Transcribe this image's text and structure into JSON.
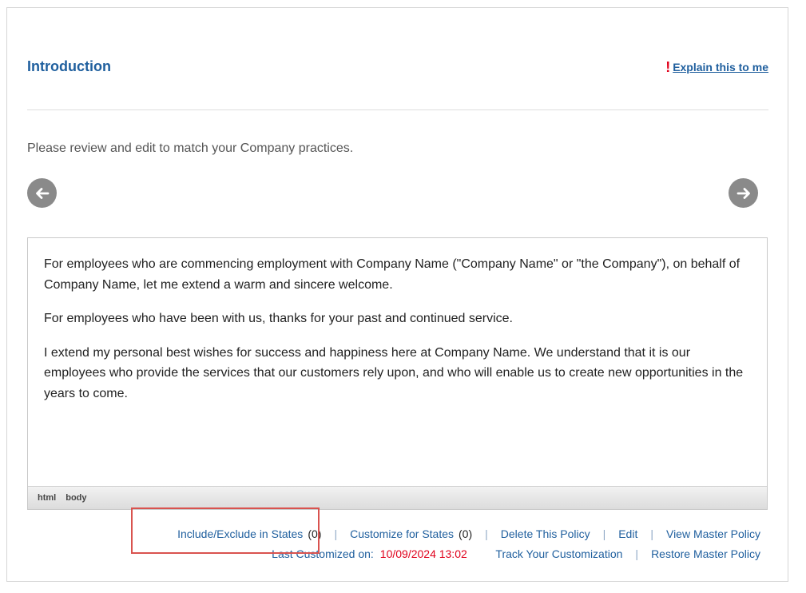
{
  "page": {
    "title": "Introduction",
    "explain_link": "Explain this to me",
    "instructions": "Please review and edit to match your Company practices."
  },
  "navigation": {
    "prev_icon": "arrow-left-icon",
    "next_icon": "arrow-right-icon"
  },
  "editor": {
    "paragraphs": [
      "For employees who are commencing employment with Company Name (\"Company Name\" or \"the Company\"), on behalf of Company Name, let me extend a warm and sincere welcome.",
      "For employees who have been with us, thanks for your past and continued service.",
      "I extend my personal best wishes for success and happiness here at Company Name. We understand that it is our employees who provide the services that our customers rely upon, and who will enable us to create new opportunities in the years to come."
    ],
    "status_path": [
      "html",
      "body"
    ]
  },
  "actions": {
    "include_exclude": "Include/Exclude in States",
    "include_exclude_count": "(0)",
    "customize_states": "Customize for States",
    "customize_states_count": "(0)",
    "delete_policy": "Delete This Policy",
    "edit": "Edit",
    "view_master": "View Master Policy",
    "last_customized_label": "Last Customized on:",
    "last_customized_date": "10/09/2024 13:02",
    "track_customization": "Track Your Customization",
    "restore_master": "Restore Master Policy",
    "separator": "|"
  },
  "colors": {
    "accent": "#1f5f9e",
    "alert": "#e0001b",
    "highlight": "#d9534f"
  }
}
